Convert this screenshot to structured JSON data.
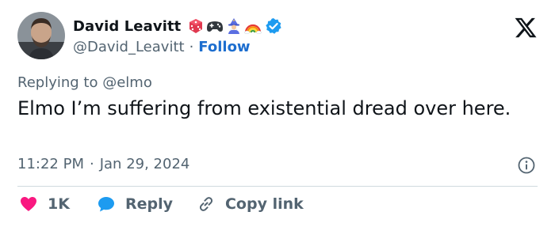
{
  "author": {
    "display_name": "David Leavitt",
    "handle": "@David_Leavitt",
    "separator": "·",
    "follow_label": "Follow",
    "name_emojis": [
      "game-die-icon",
      "video-game-icon",
      "mage-icon",
      "rainbow-icon"
    ],
    "verified": true
  },
  "tweet": {
    "reply_prefix": "Replying to",
    "reply_handle": "@elmo",
    "text": "Elmo I’m suffering from existential dread over here.",
    "time": "11:22 PM",
    "separator": "·",
    "date": "Jan 29, 2024"
  },
  "actions": {
    "like_count": "1K",
    "reply_label": "Reply",
    "copy_link_label": "Copy link"
  },
  "colors": {
    "accent": "#1d9bf0",
    "follow": "#1d6ecf",
    "like": "#f91880",
    "muted": "#536471",
    "text": "#0f1419",
    "divider": "#cfd9de"
  }
}
